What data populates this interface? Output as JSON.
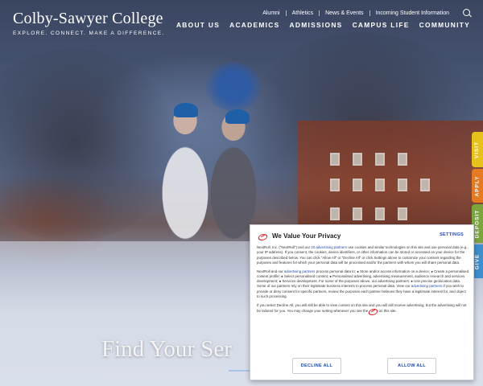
{
  "brand": {
    "name": "Colby-Sawyer College",
    "tagline": "EXPLORE. CONNECT. MAKE A DIFFERENCE."
  },
  "utility_nav": [
    "Alumni",
    "Athletics",
    "News & Events",
    "Incoming Student Information"
  ],
  "main_nav": [
    "ABOUT US",
    "ACADEMICS",
    "ADMISSIONS",
    "CAMPUS LIFE",
    "COMMUNITY"
  ],
  "side_tabs": {
    "visit": "VISIT",
    "apply": "APPLY",
    "deposit": "DEPOSIT",
    "give": "GIVE"
  },
  "hero": {
    "headline": "Find Your Ser"
  },
  "consent": {
    "title": "We Value Your Privacy",
    "settings_label": "SETTINGS",
    "p1_a": "NextRoll, Inc. (\"NextRoll\") and our ",
    "p1_link": "20 advertising partners",
    "p1_b": " use cookies and similar technologies on this site and use personal data (e.g., your IP address). If you consent, the cookies, device identifiers, or other information can be stored or accessed on your device for the purposes described below. You can click \"Allow All\" or \"Decline All\" or click Settings above to customize your consent regarding the purposes and features for which your personal data will be processed and/or the partners with whom you will share personal data.",
    "p2_a": "NextRoll and our ",
    "p2_link1": "advertising partners",
    "p2_b": " process personal data to: ● Store and/or access information on a device; ● Create a personalised content profile; ● Select personalised content; ● Personalised advertising, advertising measurement, audience research and services development; ● Services development. For some of the purposes above, our advertising partners: ● Use precise geolocation data. Some of our partners rely on their legitimate business interests to process personal data. View our ",
    "p2_link2": "advertising partners",
    "p2_c": " if you wish to provide or deny consent for specific partners, review the purposes each partner believes they have a legitimate interest for, and object to such processing.",
    "p3_a": "If you select Decline All, you will still be able to view content on this site and you will still receive advertising, but the advertising will not be tailored for you. You may change your setting whenever you see the ",
    "p3_b": " on this site.",
    "decline_label": "DECLINE ALL",
    "allow_label": "ALLOW ALL"
  }
}
